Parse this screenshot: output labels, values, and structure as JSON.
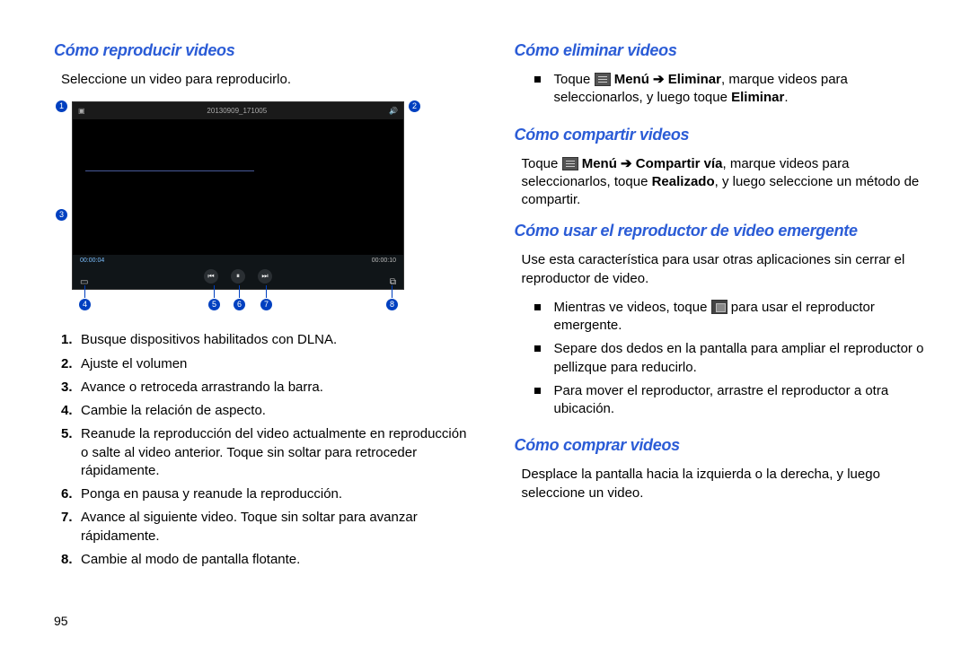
{
  "page_number": "95",
  "left": {
    "heading": "Cómo reproducir videos",
    "intro": "Seleccione un video para reproducirlo.",
    "player": {
      "timestamp": "20130909_171005",
      "time_elapsed": "00:00:04",
      "time_total": "00:00:10"
    },
    "callouts": [
      "1",
      "2",
      "3",
      "4",
      "5",
      "6",
      "7",
      "8"
    ],
    "steps": [
      "Busque dispositivos habilitados con DLNA.",
      "Ajuste el volumen",
      "Avance o retroceda arrastrando la barra.",
      "Cambie la relación de aspecto.",
      "Reanude la reproducción del video actualmente en reproducción o salte al video anterior. Toque sin soltar para retroceder rápidamente.",
      "Ponga en pausa y reanude la reproducción.",
      "Avance al siguiente video. Toque sin soltar para avanzar rápidamente.",
      "Cambie al modo de pantalla flotante."
    ]
  },
  "right": {
    "delete_heading": "Cómo eliminar videos",
    "delete_pre": "Toque ",
    "delete_menu": " Menú ",
    "delete_arrow": "➔",
    "delete_action": " Eliminar",
    "delete_post": ", marque videos para seleccionarlos, y luego toque ",
    "delete_final": "Eliminar",
    "delete_period": ".",
    "share_heading": "Cómo compartir videos",
    "share_pre": "Toque ",
    "share_menu": " Menú ",
    "share_arrow": "➔",
    "share_action": " Compartir vía",
    "share_post": ", marque videos para seleccionarlos, toque ",
    "share_done": "Realizado",
    "share_end": ", y luego seleccione un método de compartir.",
    "popup_heading": "Cómo usar el reproductor de video emergente",
    "popup_intro": "Use esta característica para usar otras aplicaciones sin cerrar el reproductor de video.",
    "popup_b1_pre": "Mientras ve videos, toque ",
    "popup_b1_post": " para usar el reproductor emergente.",
    "popup_b2": "Separe dos dedos en la pantalla para ampliar el reproductor o pellizque para reducirlo.",
    "popup_b3": "Para mover el reproductor, arrastre el reproductor a otra ubicación.",
    "buy_heading": "Cómo comprar videos",
    "buy_body": "Desplace la pantalla hacia la izquierda o la derecha, y luego seleccione un video."
  }
}
